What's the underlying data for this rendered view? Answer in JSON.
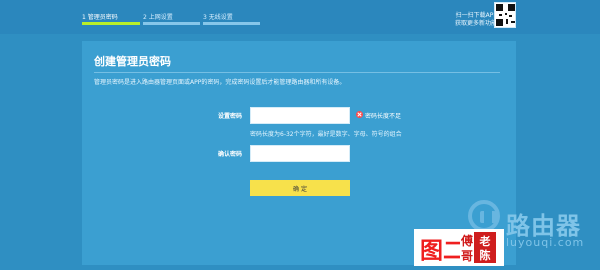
{
  "wizard": {
    "steps": [
      {
        "label": "1 管理员密码"
      },
      {
        "label": "2 上网设置"
      },
      {
        "label": "3 无线设置"
      }
    ]
  },
  "app_prompt": {
    "line1": "扫一扫下载APP",
    "line2": "获取更多新功能"
  },
  "form": {
    "title": "创建管理员密码",
    "description": "管理员密码是进入路由器管理页面或APP的密码，完成密码设置后才能管理路由器和所有设备。",
    "password": {
      "label": "设置密码",
      "value": "",
      "placeholder": "",
      "error": "密码长度不足",
      "hint": "密码长度为6-32个字符，最好是数字、字母、符号的组合"
    },
    "confirm_password": {
      "label": "确认密码",
      "value": "",
      "placeholder": ""
    },
    "confirm_button": "确 定"
  },
  "overlay": {
    "watermark_text": "路由器",
    "watermark_domain": "luyouqi.com",
    "caption": "图二",
    "seal_left_top": "傅",
    "seal_left_bottom": "哥",
    "seal_right_top": "老",
    "seal_right_bottom": "陈"
  },
  "colors": {
    "background": "#2f8fc2",
    "panel": "#3b9fd1",
    "progress_active": "#b8ef2a",
    "button": "#f7e14b",
    "error": "#ff4b4b",
    "caption": "#ef1f1f"
  },
  "icons": {
    "error": "error-icon",
    "watermark_logo": "router-logo-icon",
    "qr": "qr-code-icon"
  }
}
